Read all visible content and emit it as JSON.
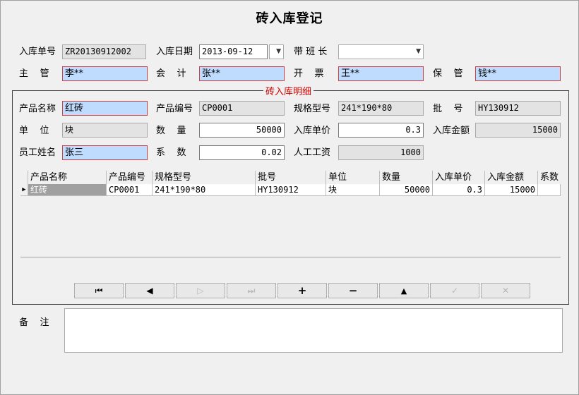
{
  "title": "砖入库登记",
  "header": {
    "receipt_no_label": "入库单号",
    "receipt_no": "ZR20130912002",
    "date_label": "入库日期",
    "date": "2013-09-12",
    "foreman_label": "带 班 长",
    "foreman": "",
    "supervisor_label": "主    管",
    "supervisor": "李**",
    "accountant_label": "会    计",
    "accountant": "张**",
    "invoice_label": "开    票",
    "invoice": "王**",
    "keeper_label": "保    管",
    "keeper": "钱**"
  },
  "detail": {
    "group_title": "砖入库明细",
    "product_name_label": "产品名称",
    "product_name": "红砖",
    "product_code_label": "产品编号",
    "product_code": "CP0001",
    "spec_label": "规格型号",
    "spec": "241*190*80",
    "batch_label": "批    号",
    "batch": "HY130912",
    "unit_label": "单    位",
    "unit": "块",
    "quantity_label": "数    量",
    "quantity": "50000",
    "unit_price_label": "入库单价",
    "unit_price": "0.3",
    "amount_label": "入库金额",
    "amount": "15000",
    "employee_label": "员工姓名",
    "employee": "张三",
    "coef_label": "系    数",
    "coef": "0.02",
    "wage_label": "人工工资",
    "wage": "1000"
  },
  "grid": {
    "columns": [
      "产品名称",
      "产品编号",
      "规格型号",
      "批号",
      "单位",
      "数量",
      "入库单价",
      "入库金额",
      "系数"
    ],
    "rows": [
      [
        "红砖",
        "CP0001",
        "241*190*80",
        "HY130912",
        "块",
        "50000",
        "0.3",
        "15000",
        ""
      ]
    ]
  },
  "navigator": {
    "first": "⏮",
    "prior": "◀",
    "next": "▷",
    "last": "⏭",
    "insert": "+",
    "delete": "−",
    "edit": "▲",
    "post": "✓",
    "cancel": "✕"
  },
  "memo": {
    "label": "备    注",
    "value": ""
  }
}
